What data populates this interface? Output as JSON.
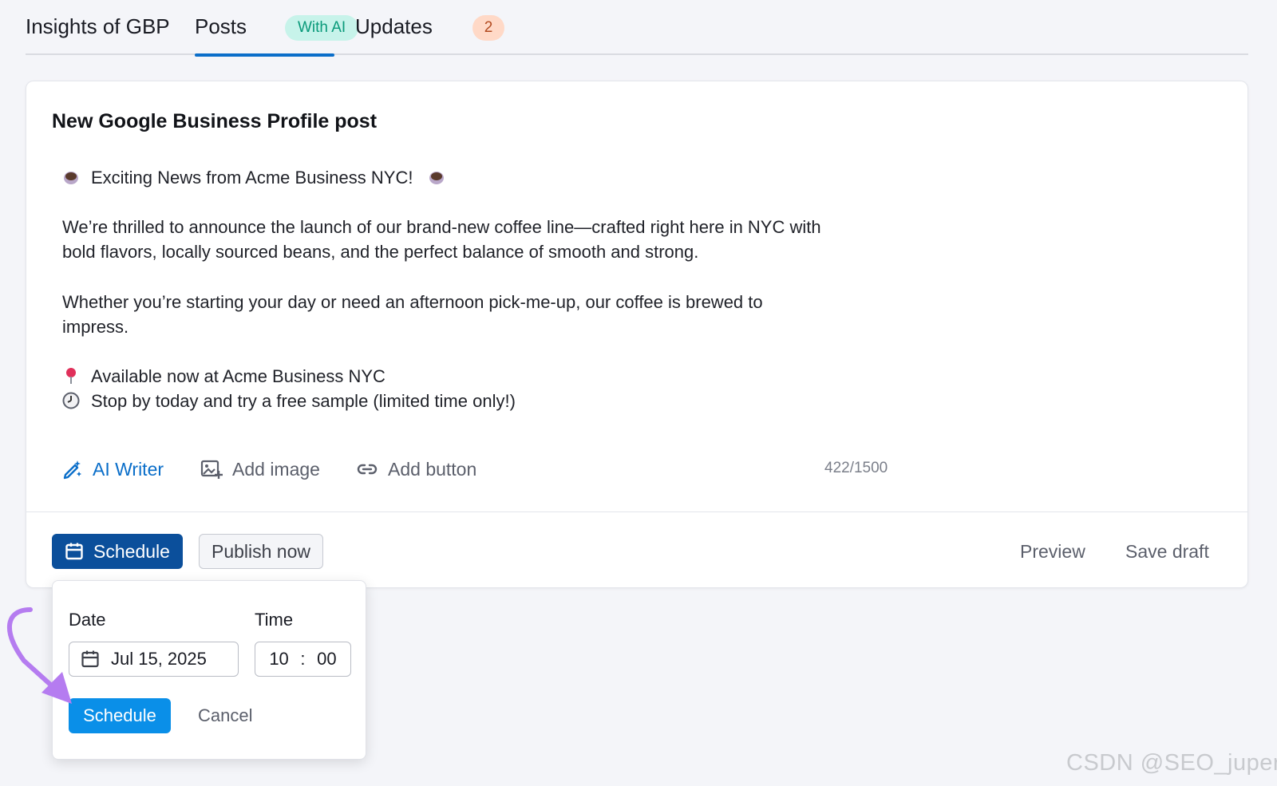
{
  "tabs": {
    "insights_label": "Insights of GBP",
    "posts_label": "Posts",
    "posts_badge": "With AI",
    "updates_label": "Updates",
    "updates_badge": "2",
    "active_color": "#0a6ec9"
  },
  "card": {
    "title": "New Google Business Profile post",
    "post_lines": [
      "Exciting News from Acme Business NYC!",
      "We’re thrilled to announce the launch of our brand-new coffee line—crafted right here in NYC with",
      "bold flavors, locally sourced beans, and the perfect balance of smooth and strong.",
      "Whether you’re starting your day or need an afternoon pick-me-up, our coffee is brewed to",
      "impress.",
      "Available now at Acme Business NYC",
      "Stop by today and try a free sample (limited time only!)"
    ],
    "icons": {
      "headline": "coffee-icon",
      "location": "pin-icon",
      "time": "clock-icon"
    },
    "toolbar": {
      "ai_writer": "AI Writer",
      "add_image": "Add image",
      "add_button": "Add button",
      "char_count": "422/1500"
    },
    "actions": {
      "schedule": "Schedule",
      "publish_now": "Publish now",
      "preview": "Preview",
      "save_draft": "Save draft",
      "schedule_color": "#0b4f9b"
    }
  },
  "schedule_popover": {
    "date_label": "Date",
    "date_value": "Jul 15, 2025",
    "time_label": "Time",
    "time_hour": "10",
    "time_sep": ":",
    "time_minute": "00",
    "schedule_button": "Schedule",
    "cancel_button": "Cancel",
    "button_color": "#0a8fe8"
  },
  "annotation_arrow_color": "#b57cf0",
  "watermark": "CSDN @SEO_juper"
}
